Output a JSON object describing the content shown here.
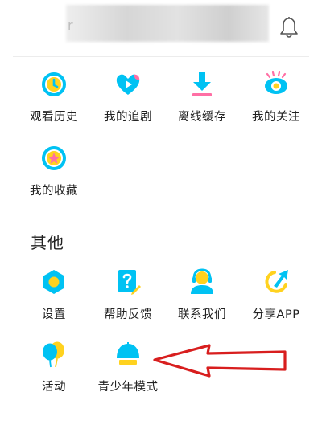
{
  "grid_top": [
    {
      "label": "观看历史",
      "icon": "clock-icon"
    },
    {
      "label": "我的追剧",
      "icon": "heart-play-icon"
    },
    {
      "label": "离线缓存",
      "icon": "download-icon"
    },
    {
      "label": "我的关注",
      "icon": "eye-icon"
    },
    {
      "label": "我的收藏",
      "icon": "star-icon"
    }
  ],
  "section_other": {
    "title": "其他",
    "items": [
      {
        "label": "设置",
        "icon": "settings-hexagon-icon"
      },
      {
        "label": "帮助反馈",
        "icon": "help-question-icon"
      },
      {
        "label": "联系我们",
        "icon": "contact-headset-icon"
      },
      {
        "label": "分享APP",
        "icon": "share-arrow-icon"
      },
      {
        "label": "活动",
        "icon": "balloons-icon"
      },
      {
        "label": "青少年模式",
        "icon": "umbrella-icon"
      }
    ]
  },
  "colors": {
    "cyan": "#00c2f3",
    "pink": "#ff6fa5",
    "yellow": "#ffd21f",
    "annotation_arrow": "#d81e1e"
  }
}
